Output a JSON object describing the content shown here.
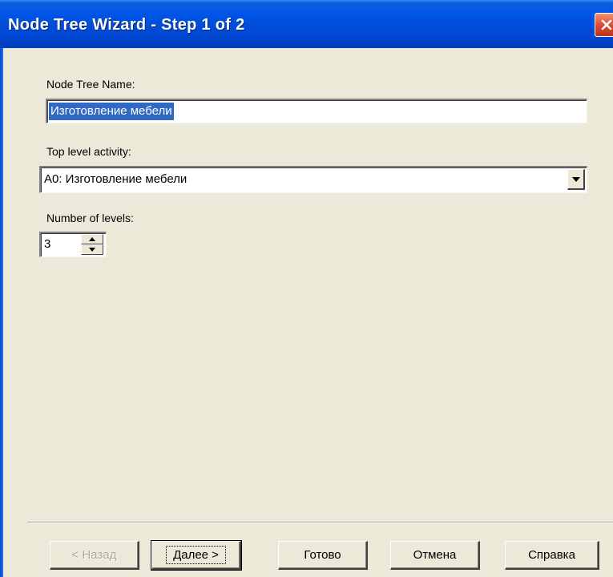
{
  "window": {
    "title": "Node Tree Wizard - Step 1 of 2",
    "close_icon": "close-x-icon"
  },
  "form": {
    "name_label": "Node Tree Name:",
    "name_value": "Изготовление мебели",
    "top_level_label": "Top level activity:",
    "top_level_value": "A0:  Изготовление мебели",
    "levels_label": "Number of levels:",
    "levels_value": "3"
  },
  "buttons": {
    "back": "< Назад",
    "next": "Далее >",
    "finish": "Готово",
    "cancel": "Отмена",
    "help": "Справка"
  },
  "colors": {
    "title_bar": "#0055e5",
    "dialog_bg": "#ece9d8",
    "selection": "#316ac5",
    "close_button": "#d8492d"
  }
}
